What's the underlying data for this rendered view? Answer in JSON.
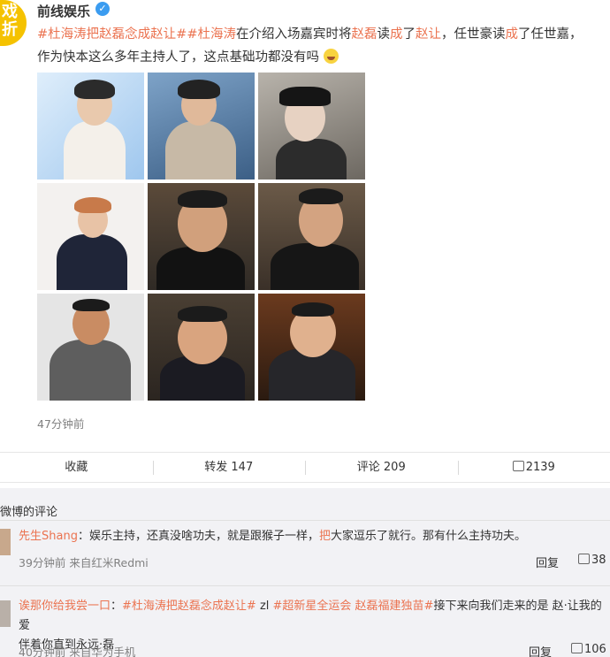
{
  "post": {
    "avatar_text": "戏\n折",
    "username": "前线娱乐",
    "verified_icon": "verified-check-icon",
    "text_parts": {
      "tag1": "#杜海涛把赵磊念成赵让#",
      "tag2": "#杜海涛",
      "p1": "在介绍入场嘉宾时将",
      "name1": "赵磊",
      "p2": "读",
      "cheng1": "成",
      "p3": "了",
      "name2": "赵让",
      "p4": "，任世豪读",
      "cheng2": "成",
      "p5": "了任世嘉，",
      "p6": "作为快本这么多年主持人了，这点基础功都没有吗"
    },
    "time": "47分钟前"
  },
  "actions": {
    "favorite": "收藏",
    "repost": "转发 147",
    "comment": "评论 209",
    "like": "2139"
  },
  "comments_section": {
    "title": "微博的评论",
    "comments": [
      {
        "user": "先生Shang",
        "text_a": "：娱乐主持，还真没啥功夫，就是跟猴子一样，",
        "hl": "把",
        "text_b": "大家逗乐了就行。那有什么主持功夫。",
        "meta": "39分钟前 来自红米Redmi",
        "reply": "回复",
        "likes": "38"
      },
      {
        "user": "诶那你给我尝一口",
        "sep": "：",
        "tag1": "#杜海涛把赵磊念成赵让#",
        "mid1": " zl ",
        "tag2": "#超新星全运会 赵磊福建独苗#",
        "text_a": "接下来向我们走来的是 赵·让我的爱",
        "text_b": "伴着你直到永远·磊",
        "meta": "40分钟前 来自华为手机",
        "reply": "回复",
        "likes": "106"
      }
    ]
  }
}
